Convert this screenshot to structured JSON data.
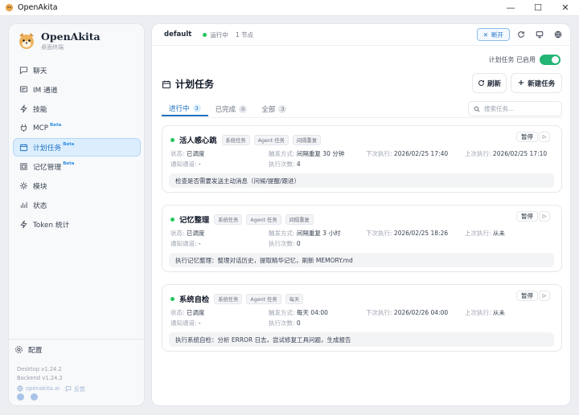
{
  "window": {
    "title": "OpenAkita"
  },
  "sidebar": {
    "brand": {
      "name": "OpenAkita",
      "subtitle": "桌面终端"
    },
    "items": [
      {
        "label": "聊天",
        "icon": "chat-icon"
      },
      {
        "label": "IM 通道",
        "icon": "message-icon"
      },
      {
        "label": "技能",
        "icon": "bolt-icon"
      },
      {
        "label": "MCP",
        "icon": "plug-icon",
        "beta": "Beta"
      },
      {
        "label": "计划任务",
        "icon": "calendar-icon",
        "beta": "Beta",
        "active": true
      },
      {
        "label": "记忆管理",
        "icon": "memory-icon",
        "beta": "Beta"
      },
      {
        "label": "模块",
        "icon": "module-icon"
      },
      {
        "label": "状态",
        "icon": "status-icon"
      },
      {
        "label": "Token 统计",
        "icon": "token-icon"
      }
    ],
    "settings_label": "配置",
    "desktop_version": "Desktop v1.24.2",
    "backend_version": "Backend v1.24.2",
    "site_link": "openakita.ai",
    "feedback_link": "反馈"
  },
  "topbar": {
    "workspace": "default",
    "status": "运行中",
    "nodes": "1 节点",
    "disconnect_label": "断开"
  },
  "scheduler": {
    "label": "计划任务 已启用",
    "enabled": true
  },
  "page": {
    "title": "计划任务",
    "refresh_label": "刷新",
    "new_task_label": "新建任务",
    "search_placeholder": "搜索任务..."
  },
  "tabs": [
    {
      "label": "进行中",
      "count": "3",
      "active": true
    },
    {
      "label": "已完成",
      "count": "0"
    },
    {
      "label": "全部",
      "count": "3"
    }
  ],
  "labels": {
    "status": "状态:",
    "trigger": "触发方式:",
    "next_run": "下次执行:",
    "last_run": "上次执行:",
    "channel": "通知通道:",
    "run_count": "执行次数:",
    "pause": "暂停",
    "run": "▷"
  },
  "tasks": [
    {
      "name": "活人感心跳",
      "tags": [
        "系统任务",
        "Agent 任务",
        "间隔重复"
      ],
      "status": "已调度",
      "trigger": "间隔重复 30 分钟",
      "next_run": "2026/02/25 17:40",
      "last_run": "2026/02/25 17:10",
      "channel": "-",
      "run_count": "4",
      "description": "检查是否需要发送主动消息（问候/提醒/跟进）"
    },
    {
      "name": "记忆整理",
      "tags": [
        "系统任务",
        "Agent 任务",
        "间隔重复"
      ],
      "status": "已调度",
      "trigger": "间隔重复 3 小时",
      "next_run": "2026/02/25 18:26",
      "last_run": "从未",
      "channel": "-",
      "run_count": "0",
      "description": "执行记忆整理：整理对话历史，提取精华记忆，刷新 MEMORY.md"
    },
    {
      "name": "系统自检",
      "tags": [
        "系统任务",
        "Agent 任务",
        "每天"
      ],
      "status": "已调度",
      "trigger": "每天 04:00",
      "next_run": "2026/02/26 04:00",
      "last_run": "从未",
      "channel": "-",
      "run_count": "0",
      "description": "执行系统自检：分析 ERROR 日志，尝试修复工具问题，生成报告"
    }
  ],
  "colors": {
    "accent": "#1d6fc2",
    "active_bg": "#dceefd",
    "toggle_on": "#23b574",
    "status_dot": "#22c55e"
  }
}
